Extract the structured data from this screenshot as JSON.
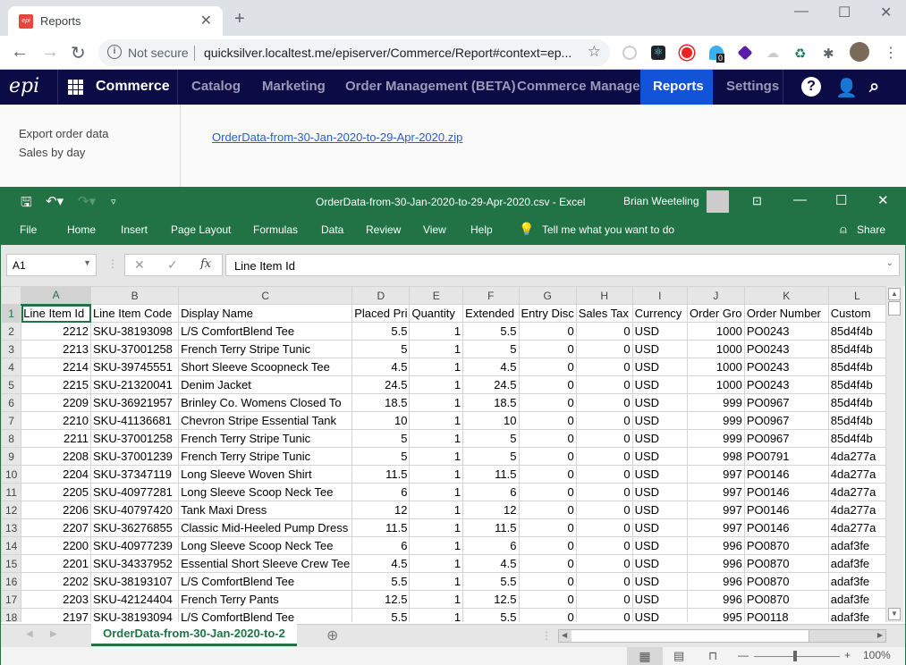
{
  "browser": {
    "tab_title": "Reports",
    "favicon": "epi-favicon",
    "not_secure": "Not secure",
    "url": "quicksilver.localtest.me/episerver/Commerce/Report#context=ep...",
    "extension_badge": "0"
  },
  "epi_nav": {
    "logo": "epi",
    "brand": "Commerce",
    "items": [
      "Catalog",
      "Marketing",
      "Order Management (BETA)",
      "Commerce Manager",
      "Reports",
      "Settings"
    ],
    "active": "Reports"
  },
  "sidebar": {
    "links": [
      "Export order data",
      "Sales by day"
    ]
  },
  "download_link": "OrderData-from-30-Jan-2020-to-29-Apr-2020.zip",
  "excel": {
    "title": "OrderData-from-30-Jan-2020-to-29-Apr-2020.csv  -  Excel",
    "user": "Brian Weeteling",
    "ribbon_tabs": [
      "File",
      "Home",
      "Insert",
      "Page Layout",
      "Formulas",
      "Data",
      "Review",
      "View",
      "Help"
    ],
    "tell_me": "Tell me what you want to do",
    "share": "Share",
    "name_box": "A1",
    "formula": "Line Item Id",
    "columns": [
      "A",
      "B",
      "C",
      "D",
      "E",
      "F",
      "G",
      "H",
      "I",
      "J",
      "K",
      "L"
    ],
    "header_row": [
      "Line Item Id",
      "Line Item Code",
      "Display Name",
      "Placed Pri",
      "Quantity",
      "Extended",
      "Entry Disc",
      "Sales Tax",
      "Currency",
      "Order Gro",
      "Order Number",
      "Custom"
    ],
    "rows": [
      [
        "2212",
        "SKU-38193098",
        "L/S ComfortBlend Tee",
        "5.5",
        "1",
        "5.5",
        "0",
        "0",
        "USD",
        "1000",
        "PO0243",
        "85d4f4b"
      ],
      [
        "2213",
        "SKU-37001258",
        "French Terry Stripe Tunic",
        "5",
        "1",
        "5",
        "0",
        "0",
        "USD",
        "1000",
        "PO0243",
        "85d4f4b"
      ],
      [
        "2214",
        "SKU-39745551",
        "Short Sleeve Scoopneck Tee",
        "4.5",
        "1",
        "4.5",
        "0",
        "0",
        "USD",
        "1000",
        "PO0243",
        "85d4f4b"
      ],
      [
        "2215",
        "SKU-21320041",
        "Denim Jacket",
        "24.5",
        "1",
        "24.5",
        "0",
        "0",
        "USD",
        "1000",
        "PO0243",
        "85d4f4b"
      ],
      [
        "2209",
        "SKU-36921957",
        "Brinley Co. Womens Closed To",
        "18.5",
        "1",
        "18.5",
        "0",
        "0",
        "USD",
        "999",
        "PO0967",
        "85d4f4b"
      ],
      [
        "2210",
        "SKU-41136681",
        "Chevron Stripe Essential Tank",
        "10",
        "1",
        "10",
        "0",
        "0",
        "USD",
        "999",
        "PO0967",
        "85d4f4b"
      ],
      [
        "2211",
        "SKU-37001258",
        "French Terry Stripe Tunic",
        "5",
        "1",
        "5",
        "0",
        "0",
        "USD",
        "999",
        "PO0967",
        "85d4f4b"
      ],
      [
        "2208",
        "SKU-37001239",
        "French Terry Stripe Tunic",
        "5",
        "1",
        "5",
        "0",
        "0",
        "USD",
        "998",
        "PO0791",
        "4da277a"
      ],
      [
        "2204",
        "SKU-37347119",
        "Long Sleeve Woven Shirt",
        "11.5",
        "1",
        "11.5",
        "0",
        "0",
        "USD",
        "997",
        "PO0146",
        "4da277a"
      ],
      [
        "2205",
        "SKU-40977281",
        "Long Sleeve Scoop Neck Tee",
        "6",
        "1",
        "6",
        "0",
        "0",
        "USD",
        "997",
        "PO0146",
        "4da277a"
      ],
      [
        "2206",
        "SKU-40797420",
        "Tank Maxi Dress",
        "12",
        "1",
        "12",
        "0",
        "0",
        "USD",
        "997",
        "PO0146",
        "4da277a"
      ],
      [
        "2207",
        "SKU-36276855",
        "Classic Mid-Heeled Pump Dress",
        "11.5",
        "1",
        "11.5",
        "0",
        "0",
        "USD",
        "997",
        "PO0146",
        "4da277a"
      ],
      [
        "2200",
        "SKU-40977239",
        "Long Sleeve Scoop Neck Tee",
        "6",
        "1",
        "6",
        "0",
        "0",
        "USD",
        "996",
        "PO0870",
        "adaf3fe"
      ],
      [
        "2201",
        "SKU-34337952",
        "Essential Short Sleeve Crew Tee",
        "4.5",
        "1",
        "4.5",
        "0",
        "0",
        "USD",
        "996",
        "PO0870",
        "adaf3fe"
      ],
      [
        "2202",
        "SKU-38193107",
        "L/S ComfortBlend Tee",
        "5.5",
        "1",
        "5.5",
        "0",
        "0",
        "USD",
        "996",
        "PO0870",
        "adaf3fe"
      ],
      [
        "2203",
        "SKU-42124404",
        "French Terry Pants",
        "12.5",
        "1",
        "12.5",
        "0",
        "0",
        "USD",
        "996",
        "PO0870",
        "adaf3fe"
      ],
      [
        "2197",
        "SKU-38193094",
        "L/S ComfortBlend Tee",
        "5.5",
        "1",
        "5.5",
        "0",
        "0",
        "USD",
        "995",
        "PO0118",
        "adaf3fe"
      ]
    ],
    "sheet_tab": "OrderData-from-30-Jan-2020-to-2",
    "zoom": "100%"
  },
  "colors": {
    "excel_green": "#217346",
    "epi_navy": "#0b0b45",
    "epi_active": "#1253d8",
    "link": "#2a5bd7"
  }
}
